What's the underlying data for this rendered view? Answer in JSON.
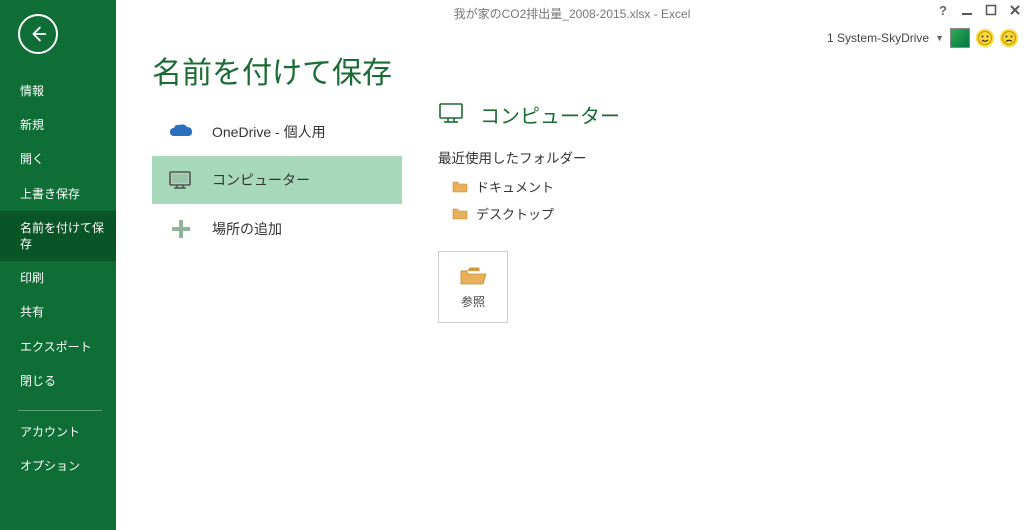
{
  "window": {
    "title": "我が家のCO2排出量_2008-2015.xlsx - Excel",
    "user_label": "1 System-SkyDrive"
  },
  "sidebar": {
    "items": [
      {
        "label": "情報"
      },
      {
        "label": "新規"
      },
      {
        "label": "開く"
      },
      {
        "label": "上書き保存"
      },
      {
        "label": "名前を付けて保存",
        "active": true
      },
      {
        "label": "印刷"
      },
      {
        "label": "共有"
      },
      {
        "label": "エクスポート"
      },
      {
        "label": "閉じる"
      }
    ],
    "bottom_items": [
      {
        "label": "アカウント"
      },
      {
        "label": "オプション"
      }
    ]
  },
  "page": {
    "title": "名前を付けて保存",
    "locations": [
      {
        "label": "OneDrive - 個人用"
      },
      {
        "label": "コンピューター",
        "selected": true
      },
      {
        "label": "場所の追加"
      }
    ],
    "detail": {
      "title": "コンピューター",
      "recent_label": "最近使用したフォルダー",
      "recent_folders": [
        {
          "label": "ドキュメント"
        },
        {
          "label": "デスクトップ"
        }
      ],
      "browse_label": "参照"
    }
  }
}
